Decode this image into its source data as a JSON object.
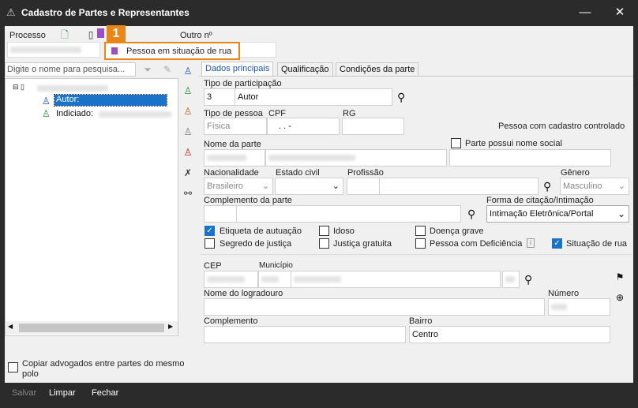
{
  "window": {
    "title": "Cadastro de Partes e Representantes",
    "minimize": "—",
    "close": "✕"
  },
  "header": {
    "processo_label": "Processo",
    "outro_label": "Outro nº"
  },
  "callout": {
    "number": "1",
    "popup_label": "Pessoa em situação de rua"
  },
  "search": {
    "placeholder": "Digite o nome para pesquisa..."
  },
  "tree": {
    "items": [
      {
        "label": "Autor:"
      },
      {
        "label": "Indiciado:"
      }
    ]
  },
  "tabs": [
    {
      "label": "Dados principais"
    },
    {
      "label": "Qualificação"
    },
    {
      "label": "Condições da parte"
    }
  ],
  "form": {
    "tipo_participacao_label": "Tipo de participação",
    "tipo_participacao_code": "3",
    "tipo_participacao_value": "Autor",
    "tipo_pessoa_label": "Tipo de pessoa",
    "tipo_pessoa_value": "Física",
    "cpf_label": "CPF",
    "cpf_value": ". . -",
    "rg_label": "RG",
    "cadastro_controlado": "Pessoa com cadastro controlado",
    "nome_parte_label": "Nome da parte",
    "nome_social_label": "Parte possui nome social",
    "nacionalidade_label": "Nacionalidade",
    "nacionalidade_value": "Brasileiro",
    "estado_civil_label": "Estado civil",
    "profissao_label": "Profissão",
    "genero_label": "Gênero",
    "genero_value": "Masculino",
    "complemento_parte_label": "Complemento da parte",
    "forma_citacao_label": "Forma de citação/Intimação",
    "forma_citacao_value": "Intimação Eletrônica/Portal",
    "cep_label": "CEP",
    "municipio_label": "Município",
    "logradouro_label": "Nome do logradouro",
    "numero_label": "Número",
    "complemento_label": "Complemento",
    "bairro_label": "Bairro",
    "bairro_value": "Centro"
  },
  "checkboxes": [
    {
      "label": "Etiqueta de autuação",
      "checked": true
    },
    {
      "label": "Idoso",
      "checked": false
    },
    {
      "label": "Doença grave",
      "checked": false
    },
    {
      "label": "Segredo de justiça",
      "checked": false
    },
    {
      "label": "Justiça gratuita",
      "checked": false
    },
    {
      "label": "Pessoa com Deficiência",
      "checked": false
    },
    {
      "label": "Situação de rua",
      "checked": true
    }
  ],
  "copy_lawyers": {
    "label": "Copiar advogados entre partes do mesmo polo"
  },
  "footer": {
    "salvar": "Salvar",
    "limpar": "Limpar",
    "fechar": "Fechar"
  },
  "colors": {
    "titlebar": "#2b2b2b",
    "accent": "#1a73c8",
    "callout": "#e8861a",
    "popup_icon": "#9b4fc0",
    "selection": "#1a73c8"
  }
}
